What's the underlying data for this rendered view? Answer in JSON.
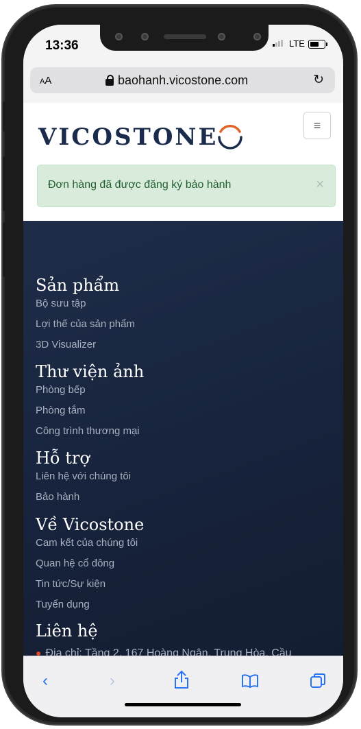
{
  "status": {
    "time": "13:36",
    "network": "LTE"
  },
  "browser": {
    "text_size": "AA",
    "url": "baohanh.vicostone.com"
  },
  "site": {
    "logo_text": "VICOSTONE",
    "menu_symbol": "≡",
    "alert": {
      "message": "Đơn hàng đã được đăng ký bảo hành",
      "close": "×"
    }
  },
  "nav": {
    "sections": [
      {
        "title": "Sản phẩm",
        "links": [
          "Bộ sưu tập",
          "Lợi thế của sản phẩm",
          "3D Visualizer"
        ]
      },
      {
        "title": "Thư viện ảnh",
        "links": [
          "Phòng bếp",
          "Phòng tắm",
          "Công trình thương mại"
        ]
      },
      {
        "title": "Hỗ trợ",
        "links": [
          "Liên hệ với chúng tôi",
          "Bảo hành"
        ]
      },
      {
        "title": "Về Vicostone",
        "links": [
          "Cam kết của chúng tôi",
          "Quan hệ cổ đông",
          "Tin tức/Sự kiện",
          "Tuyển dụng"
        ]
      },
      {
        "title": "Liên hệ",
        "links": []
      }
    ],
    "address": "Địa chỉ: Tầng 2, 167 Hoàng Ngân, Trung Hòa, Cầu"
  },
  "toolbar": {
    "back_icon": "chevron-left-icon",
    "forward_icon": "chevron-right-icon",
    "share_icon": "share-icon",
    "bookmarks_icon": "book-icon",
    "tabs_icon": "tabs-icon"
  },
  "colors": {
    "accent": "#2874f0",
    "brand_navy": "#1a2b4c",
    "brand_orange": "#e0642a",
    "footer_bg": "#1b2842",
    "alert_bg": "#d9ecdb"
  }
}
